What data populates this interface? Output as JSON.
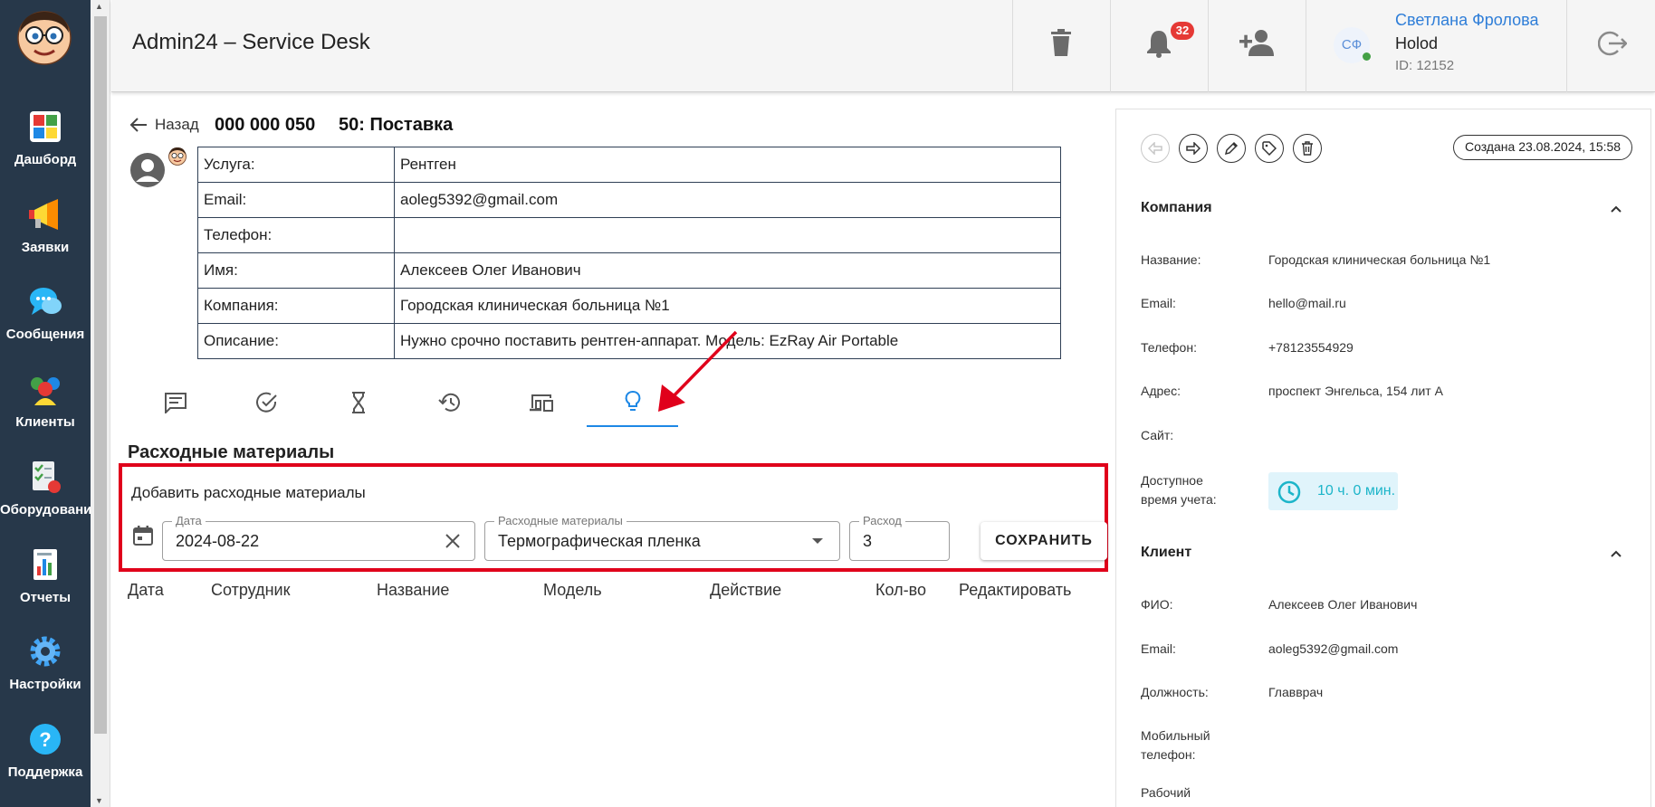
{
  "app": {
    "title": "Admin24 – Service Desk"
  },
  "sidebar": {
    "items": [
      {
        "label": "Дашборд",
        "icon": "dashboard-icon"
      },
      {
        "label": "Заявки",
        "icon": "megaphone-icon"
      },
      {
        "label": "Сообщения",
        "icon": "chat-bubbles-icon"
      },
      {
        "label": "Клиенты",
        "icon": "people-icon"
      },
      {
        "label": "Оборудование",
        "icon": "equipment-checklist-icon"
      },
      {
        "label": "Отчеты",
        "icon": "report-chart-icon"
      },
      {
        "label": "Настройки",
        "icon": "gear-icon"
      },
      {
        "label": "Поддержка",
        "icon": "help-icon"
      }
    ]
  },
  "header": {
    "notifications_count": "32",
    "user": {
      "initials": "СФ",
      "name": "Светлана Фролова",
      "org": "Holod",
      "id": "ID: 12152"
    }
  },
  "ticket": {
    "back_label": "Назад",
    "number": "000 000 050",
    "title": "50: Поставка",
    "fields": [
      {
        "label": "Услуга:",
        "value": "Рентген"
      },
      {
        "label": "Email:",
        "value": "aoleg5392@gmail.com"
      },
      {
        "label": "Телефон:",
        "value": ""
      },
      {
        "label": "Имя:",
        "value": "Алексеев Олег Иванович"
      },
      {
        "label": "Компания:",
        "value": "Городская клиническая больница №1"
      },
      {
        "label": "Описание:",
        "value": "Нужно срочно поставить рентген-аппарат. Модель: EzRay Air Portable"
      }
    ]
  },
  "tabs": [
    {
      "icon": "comment-icon",
      "active": false
    },
    {
      "icon": "check-circle-icon",
      "active": false
    },
    {
      "icon": "hourglass-icon",
      "active": false
    },
    {
      "icon": "history-icon",
      "active": false
    },
    {
      "icon": "devices-icon",
      "active": false
    },
    {
      "icon": "lightbulb-icon",
      "active": true
    }
  ],
  "consumables": {
    "section_title": "Расходные материалы",
    "add_label": "Добавить расходные материалы",
    "date_label": "Дата",
    "date_value": "2024-08-22",
    "material_label": "Расходные материалы",
    "material_value": "Термографическая пленка",
    "amount_label": "Расход",
    "amount_value": "3",
    "save_label": "СОХРАНИТЬ",
    "columns": [
      "Дата",
      "Сотрудник",
      "Название",
      "Модель",
      "Действие",
      "Кол-во",
      "Редактировать"
    ]
  },
  "right_panel": {
    "created": "Создана 23.08.2024, 15:58",
    "company": {
      "title": "Компания",
      "name_label": "Название:",
      "name": "Городская клиническая больница №1",
      "email_label": "Email:",
      "email": "hello@mail.ru",
      "phone_label": "Телефон:",
      "phone": "+78123554929",
      "address_label": "Адрес:",
      "address": "проспект Энгельса, 154 лит А",
      "site_label": "Сайт:",
      "site": "",
      "time_label": "Доступное время учета:",
      "time": "10 ч. 0 мин."
    },
    "client": {
      "title": "Клиент",
      "fio_label": "ФИО:",
      "fio": "Алексеев Олег Иванович",
      "email_label": "Email:",
      "email": "aoleg5392@gmail.com",
      "position_label": "Должность:",
      "position": "Главврач",
      "mobile_label": "Мобильный телефон:",
      "mobile": "",
      "work_label": "Рабочий"
    }
  },
  "colors": {
    "sidebar": "#27384a",
    "accent": "#1e88e5",
    "highlight": "#e0001b",
    "user_link": "#2f7ed8",
    "time": "#1cb5c9"
  }
}
